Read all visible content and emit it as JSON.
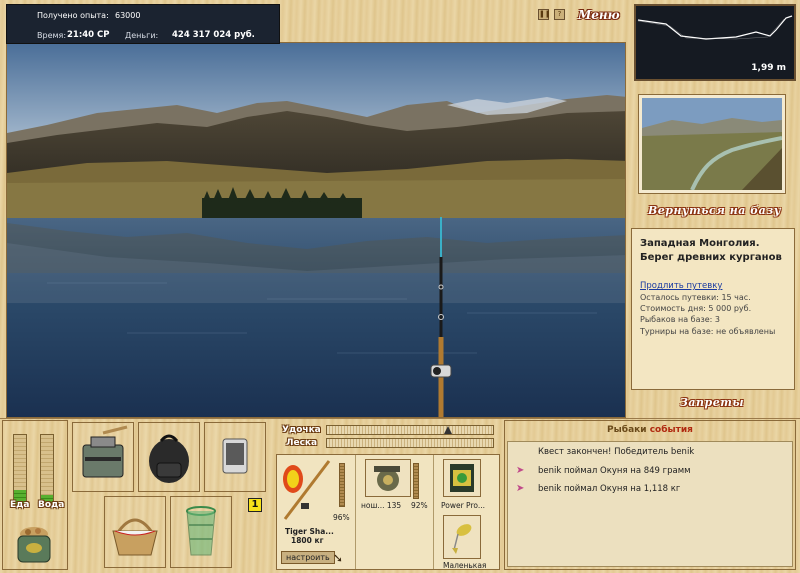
{
  "status": {
    "experience_label": "Получено опыта:",
    "experience_value": "63000",
    "time_label": "Время:",
    "time_value": "21:40 СР",
    "money_label": "Деньги:",
    "money_value": "424 317 024 руб."
  },
  "menu": {
    "label": "Меню",
    "pause_icon": "pause-icon",
    "help_icon": "?"
  },
  "depth": {
    "value": "1,99 m"
  },
  "base": {
    "return_label": "Вернуться на базу",
    "location_line1": "Западная Монголия.",
    "location_line2": "Берег древних курганов",
    "extend_link": "Продлить путевку",
    "trip_left": "Осталось путевки: 15 час.",
    "day_cost": "Стоимость дня: 5 000 руб.",
    "fishers": "Рыбаков на базе: 3",
    "tournaments": "Турниры на базе: не объявлены",
    "bans_label": "Запреты"
  },
  "needs": {
    "food_label": "Еда",
    "drink_label": "Вода",
    "food_level": 0.22,
    "drink_level": 0.15
  },
  "inventory": {
    "badge": "1",
    "items": [
      "tackle-box-icon",
      "backpack-icon",
      "phone-icon",
      "picnic-basket-icon",
      "keepnet-icon"
    ]
  },
  "rod": {
    "rod_label": "Удочка",
    "line_label": "Леска",
    "rod_tension": 0.73,
    "line_tension": 0.0
  },
  "gear": {
    "rod_name": "Tiger Sha...",
    "rod_weight": "1800 кг",
    "rod_pct": "96%",
    "reel_name": "нош... 135",
    "reel_pct": "92%",
    "line_name": "Power Pro...",
    "lure_name": "Маленькая",
    "setup_button": "настроить"
  },
  "events": {
    "title_a": "Рыбаки",
    "title_b": "события",
    "rows": [
      "Квест закончен! Победитель benik",
      "benik поймал Окуня на 849 грамм",
      "benik поймал Окуня на 1,118 кг"
    ]
  },
  "colors": {
    "accent": "#8a3210",
    "panel": "#f3e6c2",
    "status_bg": "#1b2330"
  }
}
